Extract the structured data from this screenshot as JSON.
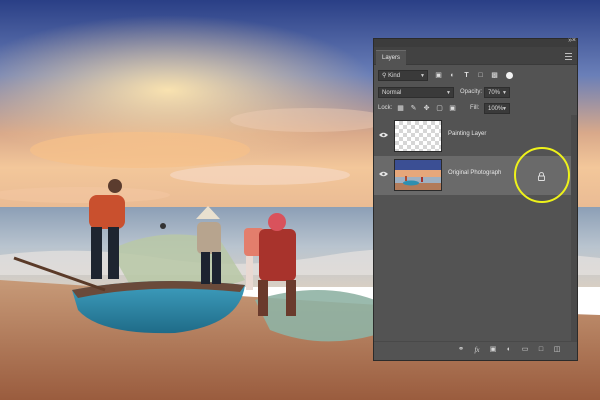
{
  "panel": {
    "tab_label": "Layers",
    "collapse_glyph": "»",
    "close_glyph": "×",
    "menu_icon": "hamburger-menu-icon"
  },
  "filter": {
    "kind_label": "Kind",
    "icons": [
      "image-filter-icon",
      "adjustment-filter-icon",
      "type-filter-icon",
      "shape-filter-icon",
      "smartobject-filter-icon"
    ]
  },
  "blend": {
    "mode": "Normal",
    "opacity_label": "Opacity:",
    "opacity_value": "70%"
  },
  "lock": {
    "label": "Lock:",
    "fill_label": "Fill:",
    "fill_value": "100%"
  },
  "layers": [
    {
      "name": "Painting Layer",
      "visible": true,
      "selected": false,
      "locked": false
    },
    {
      "name": "Original Photograph",
      "visible": true,
      "selected": true,
      "locked": true
    }
  ],
  "bottom_icons": [
    "link-layers-icon",
    "fx-icon",
    "add-mask-icon",
    "adjustment-layer-icon",
    "new-group-icon",
    "new-layer-icon",
    "delete-layer-icon"
  ],
  "fx_label": "fx",
  "colors": {
    "panel_bg": "#535353",
    "selected_row": "#6a6a6a",
    "highlight_ring": "#eef21a"
  }
}
